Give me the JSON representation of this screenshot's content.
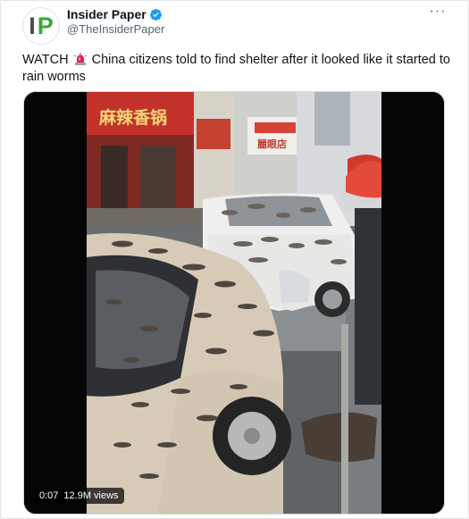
{
  "author": {
    "avatar_letters": [
      "I",
      "P"
    ],
    "name": "Insider Paper",
    "handle": "@TheInsiderPaper",
    "verified": true
  },
  "more_menu_label": "···",
  "tweet": {
    "prefix": "WATCH",
    "emoji": "siren-icon",
    "text": "China citizens told to find shelter after it looked like it started to rain worms"
  },
  "video": {
    "time": "0:07",
    "views": "12.9M views",
    "storefront_sign": "麻辣香锅",
    "shop_sign": "麗眼店"
  },
  "colors": {
    "verified": "#1d9bf0",
    "text": "#0f1419",
    "secondary": "#536471",
    "avatar_green": "#3aa83a"
  }
}
